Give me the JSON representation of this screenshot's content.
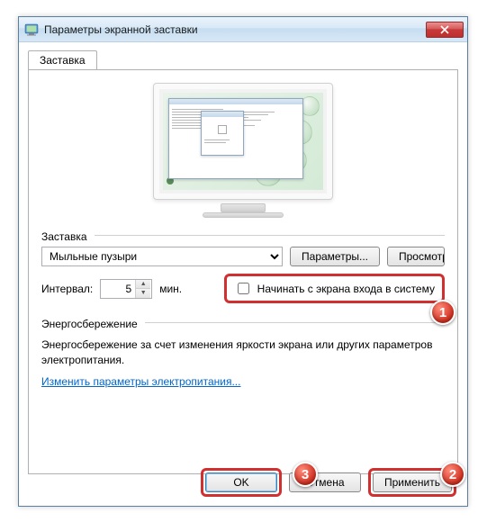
{
  "window": {
    "title": "Параметры экранной заставки"
  },
  "tab": {
    "label": "Заставка"
  },
  "screensaver": {
    "group_label": "Заставка",
    "selected": "Мыльные пузыри",
    "params_btn": "Параметры...",
    "preview_btn": "Просмотр",
    "interval_label": "Интервал:",
    "interval_value": "5",
    "interval_unit": "мин.",
    "resume_checkbox_label": "Начинать с экрана входа в систему"
  },
  "energy": {
    "group_label": "Энергосбережение",
    "text": "Энергосбережение за счет изменения яркости экрана или других параметров электропитания.",
    "link": "Изменить параметры электропитания..."
  },
  "footer": {
    "ok": "OK",
    "cancel": "Отмена",
    "apply": "Применить"
  },
  "badges": {
    "b1": "1",
    "b2": "2",
    "b3": "3"
  }
}
